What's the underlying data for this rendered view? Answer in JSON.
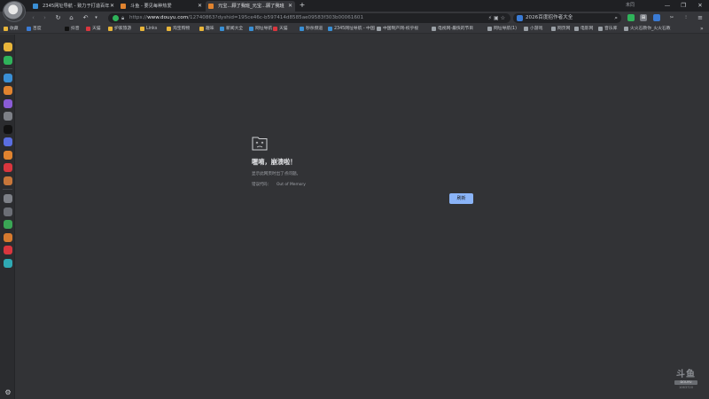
{
  "browser": {
    "tabs": [
      {
        "title": "2345网址导航 - 致力于打造百年",
        "active": false
      },
      {
        "title": "斗鱼 - 要见每种热爱",
        "active": false
      },
      {
        "title": "元宝...顾了我班_元宝...顾了我班",
        "active": true
      }
    ],
    "new_tab_label": "+",
    "tab_close_glyph": "✕",
    "user_label": "未同",
    "window_controls": {
      "minimize": "—",
      "restore": "❐",
      "close": "✕"
    }
  },
  "toolbar": {
    "back": "‹",
    "forward": "›",
    "reload": "↻",
    "home": "⌂",
    "undo": "↶",
    "url_prefix": "https://",
    "url_host": "www.douyu.com",
    "url_path": "/12740863?dyshid=195ce46c-b597414d8585ae09583f303b00061601",
    "search_placeholder": "2026百度招作者大全",
    "search_button": "⌕",
    "menu": "≡"
  },
  "bookmarks": [
    {
      "label": "收藏",
      "color": "#e8b53a"
    },
    {
      "label": "百度",
      "color": "#3a7bd5"
    },
    {
      "label": "抖音",
      "color": "#111111"
    },
    {
      "label": "天猫",
      "color": "#d9363e"
    },
    {
      "label": "护家旅游",
      "color": "#e8b53a"
    },
    {
      "label": "Links",
      "color": "#e8b53a"
    },
    {
      "label": "淘宝购物",
      "color": "#e8b53a"
    },
    {
      "label": "趣味",
      "color": "#e8b53a"
    },
    {
      "label": "新闻大全",
      "color": "#3a8fd5"
    },
    {
      "label": "网址导航",
      "color": "#3a8fd5"
    },
    {
      "label": "天猫",
      "color": "#d9363e"
    },
    {
      "label": "秒杀频道",
      "color": "#3a8fd5"
    },
    {
      "label": "2345网址导航 - 中国",
      "color": "#3a8fd5"
    },
    {
      "label": "中国制产网-权乎视",
      "color": "#9aa0a6"
    },
    {
      "label": "电视网-最快的节目",
      "color": "#9aa0a6"
    },
    {
      "label": "网址导航(1)",
      "color": "#9aa0a6"
    },
    {
      "label": "小游戏",
      "color": "#9aa0a6"
    },
    {
      "label": "网页网",
      "color": "#9aa0a6"
    },
    {
      "label": "电影网",
      "color": "#9aa0a6"
    },
    {
      "label": "音乐库",
      "color": "#9aa0a6"
    },
    {
      "label": "火火石教你_火火石教",
      "color": "#9aa0a6"
    }
  ],
  "bookmarks_more": "»",
  "sidebar": {
    "items": [
      {
        "icon": "star-icon",
        "color": "#e8b53a"
      },
      {
        "icon": "chat-icon",
        "color": "#2fb35a"
      },
      {
        "icon": "cloud-icon",
        "color": "#3a8fd5"
      },
      {
        "icon": "game-icon",
        "color": "#e0832f"
      },
      {
        "icon": "controller-icon",
        "color": "#8a5cd6"
      },
      {
        "icon": "mascot-icon",
        "color": "#7d8087"
      },
      {
        "icon": "tiktok-icon",
        "color": "#111111"
      },
      {
        "icon": "gear-app-icon",
        "color": "#5a6ee0"
      },
      {
        "icon": "rss-icon",
        "color": "#e0832f"
      },
      {
        "icon": "weibo-icon",
        "color": "#d9363e"
      },
      {
        "icon": "game2-icon",
        "color": "#c7763a"
      },
      {
        "icon": "photo-icon",
        "color": "#7d8087"
      },
      {
        "icon": "avatar-app-icon",
        "color": "#6b6e75"
      },
      {
        "icon": "frog-icon",
        "color": "#3aa655"
      },
      {
        "icon": "puzzle-icon",
        "color": "#d67a2f"
      },
      {
        "icon": "video-icon",
        "color": "#d9363e"
      },
      {
        "icon": "tv-icon",
        "color": "#2fa9b3"
      }
    ],
    "settings_glyph": "⚙"
  },
  "crash": {
    "title": "喔唷，崩溃啦！",
    "description": "显示此网页时出了点问题。",
    "code_label": "错误代码：",
    "code_value": "Out of Memory",
    "reload_label": "刷新"
  },
  "watermark": {
    "logo": "斗鱼",
    "band": "DOUYU",
    "sub": "1063720"
  }
}
